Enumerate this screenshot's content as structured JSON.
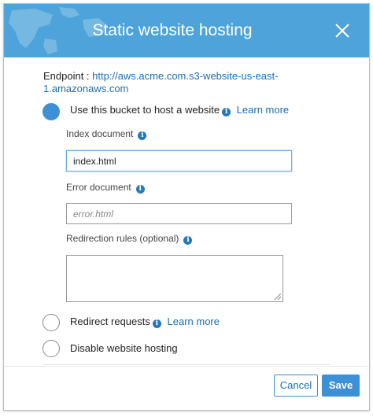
{
  "dialog": {
    "title": "Static website hosting"
  },
  "endpoint": {
    "label": "Endpoint :",
    "url": "http://aws.acme.com.s3-website-us-east-1.amazonaws.com"
  },
  "options": [
    {
      "label": "Use this bucket to host a website",
      "learn_more": "Learn more",
      "selected": true
    },
    {
      "label": "Redirect requests",
      "learn_more": "Learn more",
      "selected": false
    },
    {
      "label": "Disable website hosting",
      "selected": false
    }
  ],
  "fields": {
    "index_document": {
      "label": "Index document",
      "value": "index.html"
    },
    "error_document": {
      "label": "Error document",
      "placeholder": "error.html",
      "value": ""
    },
    "redirection_rules": {
      "label": "Redirection rules (optional)",
      "value": ""
    }
  },
  "buttons": {
    "cancel": "Cancel",
    "save": "Save"
  },
  "colors": {
    "header": "#4ea4da",
    "accent": "#3d8fd6",
    "link": "#1a6fb5"
  },
  "icons": [
    "close-icon",
    "info-icon",
    "radio-icon"
  ]
}
